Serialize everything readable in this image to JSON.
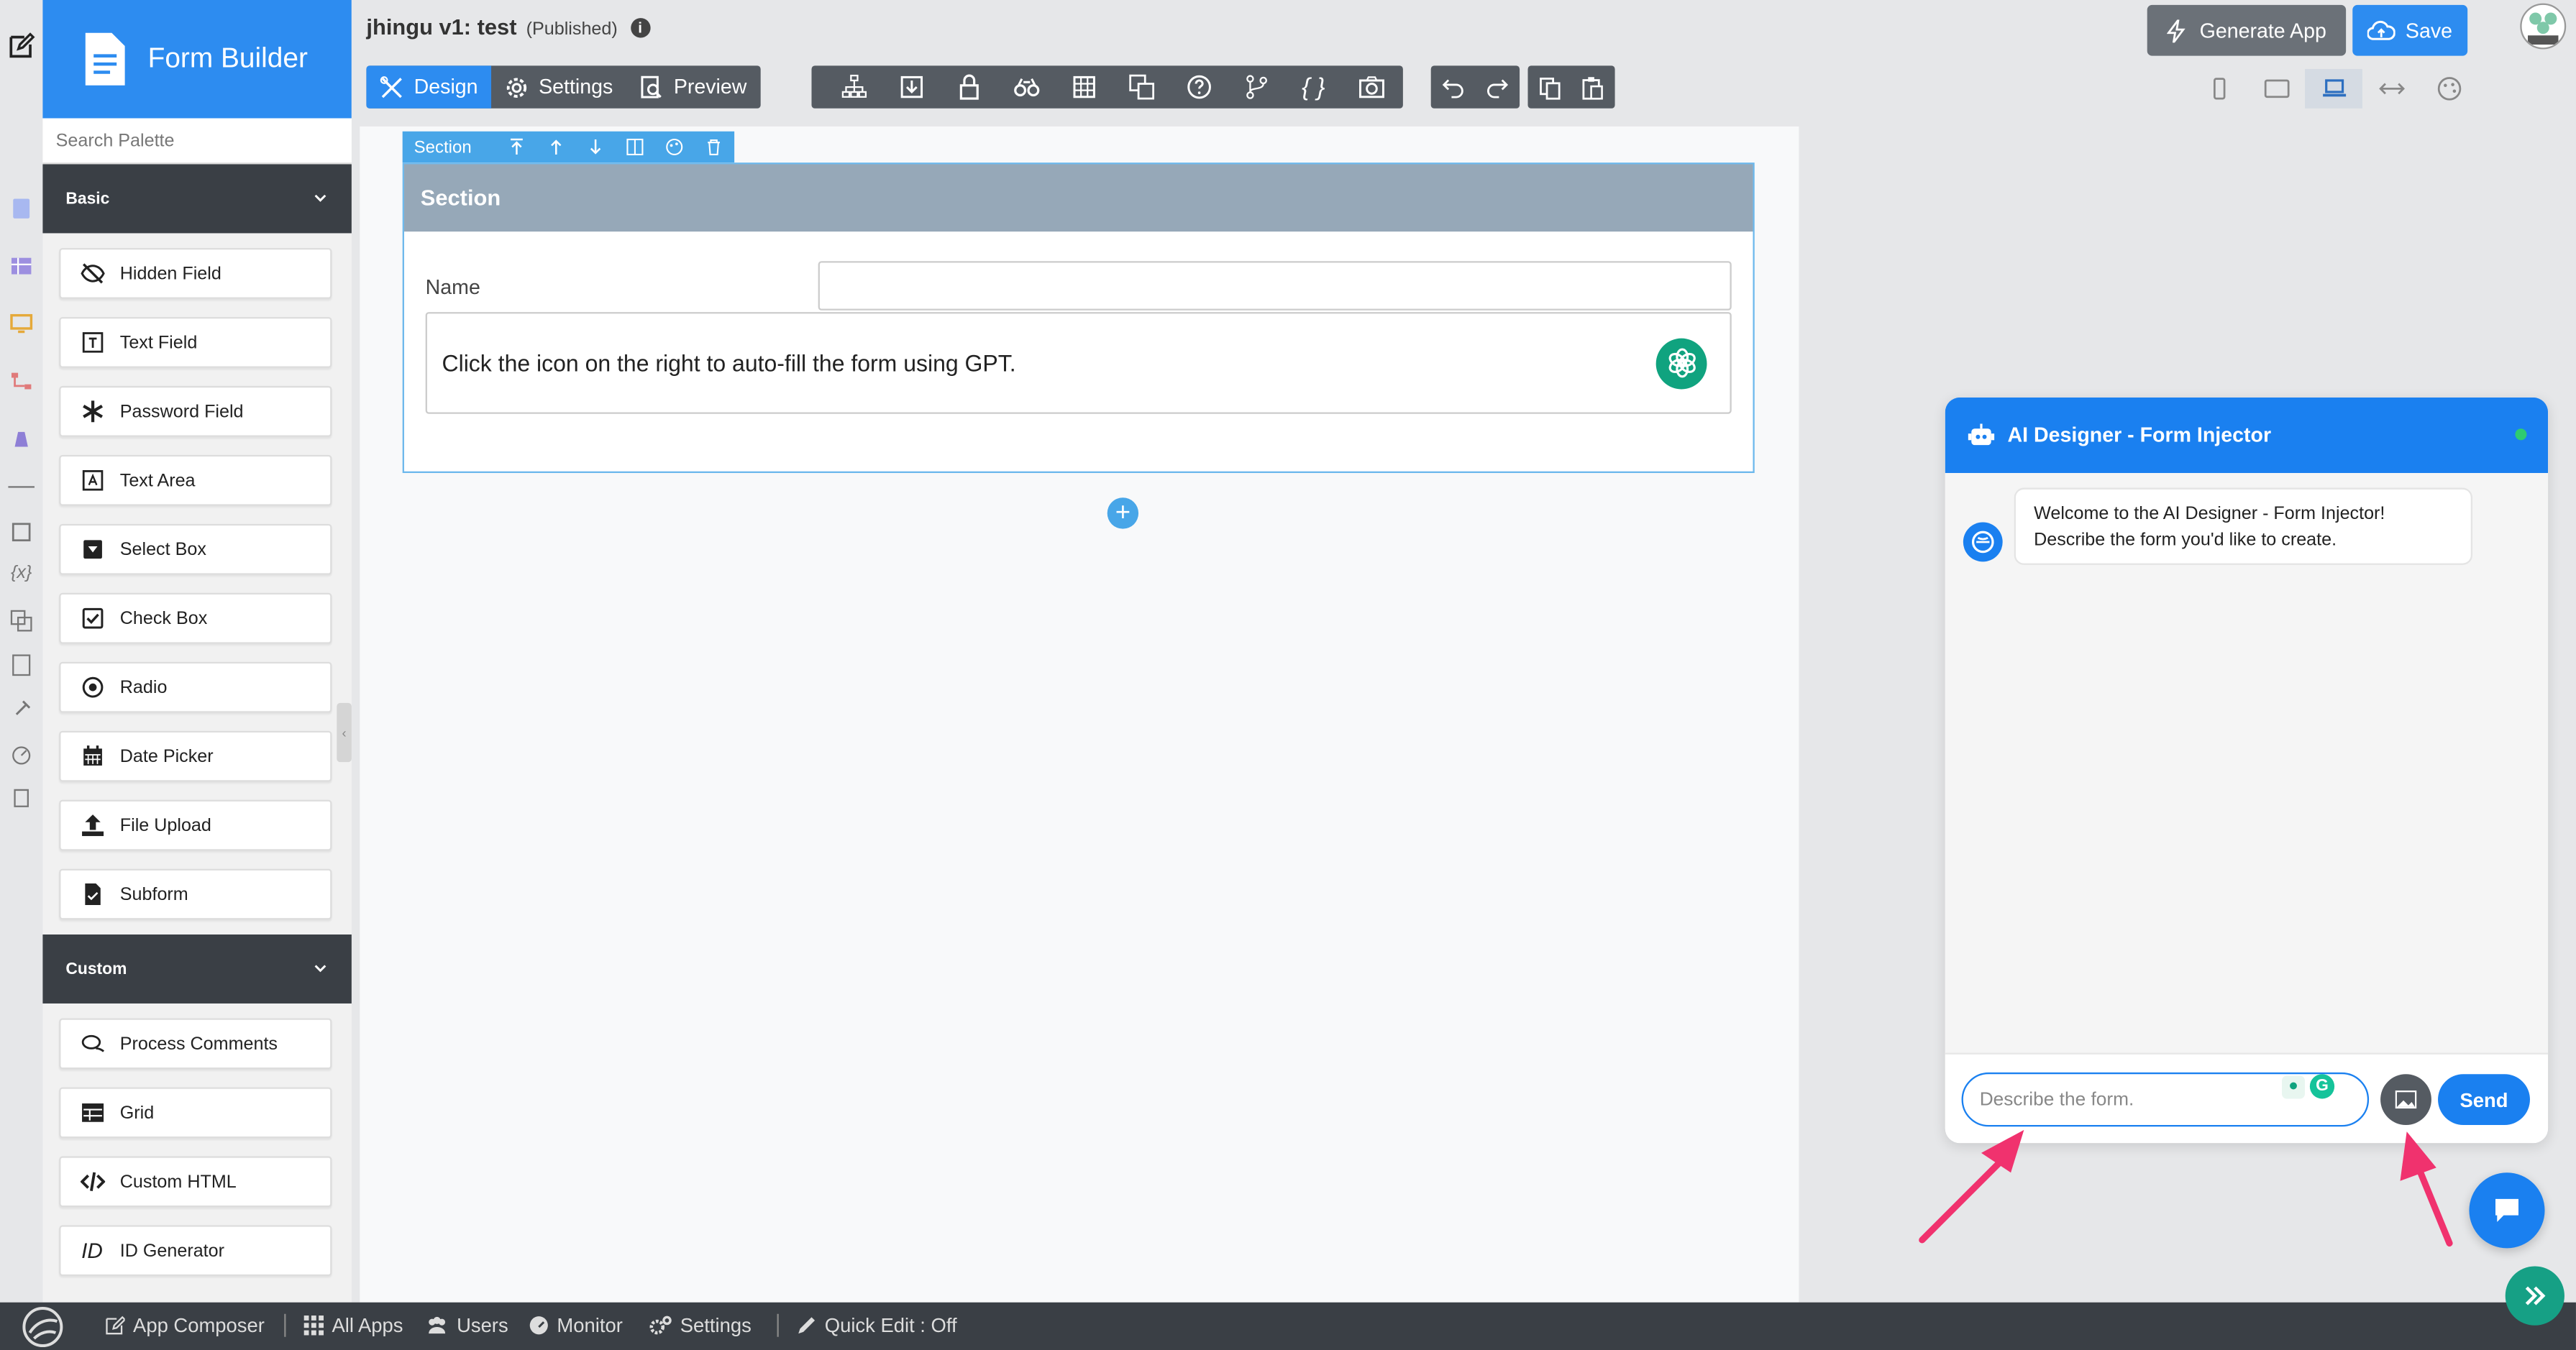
{
  "app": {
    "brand": "Form Builder",
    "title": "jhingu v1: test",
    "status": "(Published)"
  },
  "palette": {
    "search_placeholder": "Search Palette",
    "groups": [
      {
        "label": "Basic",
        "items": [
          {
            "label": "Hidden Field",
            "icon": "eye-slash-icon"
          },
          {
            "label": "Text Field",
            "icon": "text-field-icon"
          },
          {
            "label": "Password Field",
            "icon": "asterisk-icon"
          },
          {
            "label": "Text Area",
            "icon": "text-area-icon"
          },
          {
            "label": "Select Box",
            "icon": "select-box-icon"
          },
          {
            "label": "Check Box",
            "icon": "checkbox-icon"
          },
          {
            "label": "Radio",
            "icon": "radio-icon"
          },
          {
            "label": "Date Picker",
            "icon": "calendar-icon"
          },
          {
            "label": "File Upload",
            "icon": "upload-icon"
          },
          {
            "label": "Subform",
            "icon": "subform-icon"
          }
        ]
      },
      {
        "label": "Custom",
        "items": [
          {
            "label": "Process Comments",
            "icon": "comments-icon"
          },
          {
            "label": "Grid",
            "icon": "grid-icon"
          },
          {
            "label": "Custom HTML",
            "icon": "code-icon"
          },
          {
            "label": "ID Generator",
            "icon": "id-icon"
          }
        ]
      }
    ]
  },
  "tabs": [
    {
      "label": "Design",
      "active": true
    },
    {
      "label": "Settings",
      "active": false
    },
    {
      "label": "Preview",
      "active": false
    }
  ],
  "toolbar_icons": [
    "sitemap-icon",
    "import-icon",
    "lock-icon",
    "binoculars-icon",
    "table-icon",
    "translate-icon",
    "help-icon",
    "branch-icon",
    "braces-icon",
    "camera-icon"
  ],
  "actions": {
    "generate_app": "Generate App",
    "save": "Save"
  },
  "canvas": {
    "section_toolbar_label": "Section",
    "section_title": "Section",
    "name_label": "Name",
    "gpt_text": "Click the icon on the right to auto-fill the form using GPT."
  },
  "ai_panel": {
    "title": "AI Designer - Form Injector",
    "welcome_line1": "Welcome to the AI Designer - Form Injector!",
    "welcome_line2": "Describe the form you'd like to create.",
    "input_placeholder": "Describe the form.",
    "send": "Send"
  },
  "bottombar": {
    "items": [
      "App Composer",
      "All Apps",
      "Users",
      "Monitor",
      "Settings",
      "Quick Edit : Off"
    ]
  },
  "colors": {
    "primary": "#2d8cf0",
    "dark": "#3a3f45",
    "section_header": "#96a8b8",
    "gpt_green": "#10a37f",
    "annotation_arrow": "#f0326e"
  }
}
